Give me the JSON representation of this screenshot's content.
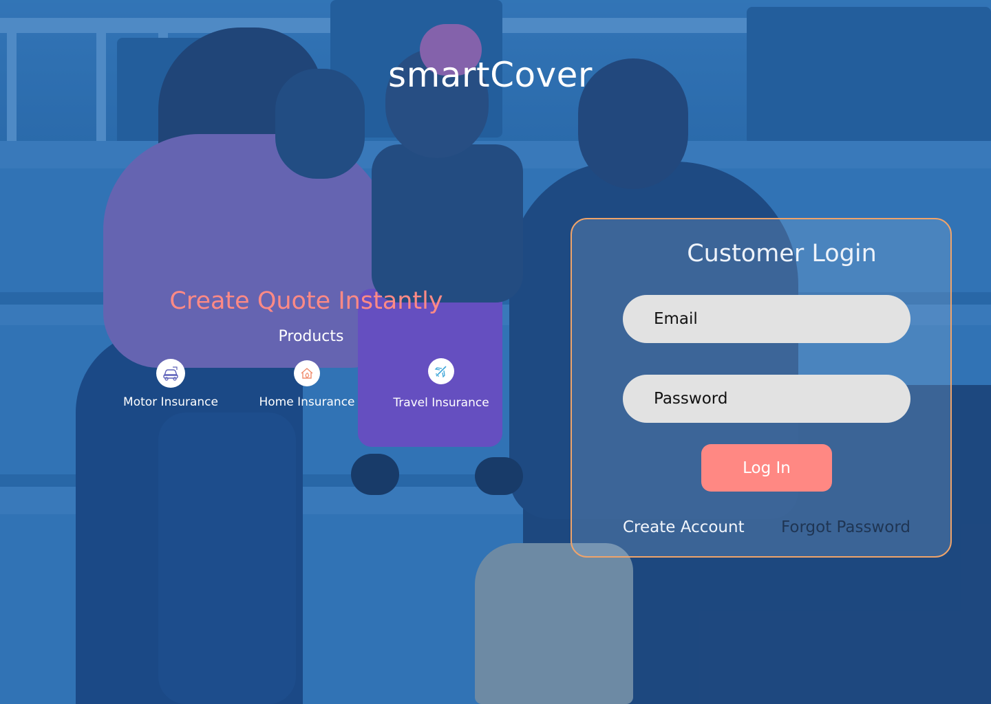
{
  "brand": {
    "name": "smartCover"
  },
  "quote": {
    "title": "Create Quote Instantly",
    "products_heading": "Products",
    "products": [
      {
        "label": "Motor Insurance",
        "icon": "car-icon"
      },
      {
        "label": "Home Insurance",
        "icon": "house-icon"
      },
      {
        "label": "Travel Insurance",
        "icon": "airplane-icon"
      }
    ]
  },
  "login": {
    "title": "Customer Login",
    "email_placeholder": "Email",
    "password_placeholder": "Password",
    "submit_label": "Log In",
    "create_account_label": "Create Account",
    "forgot_password_label": "Forgot Password"
  },
  "colors": {
    "accent_coral": "#ff8883",
    "card_border": "#f0a46a",
    "overlay_blue": "#2268b4",
    "input_fill": "#e2e2e2"
  }
}
